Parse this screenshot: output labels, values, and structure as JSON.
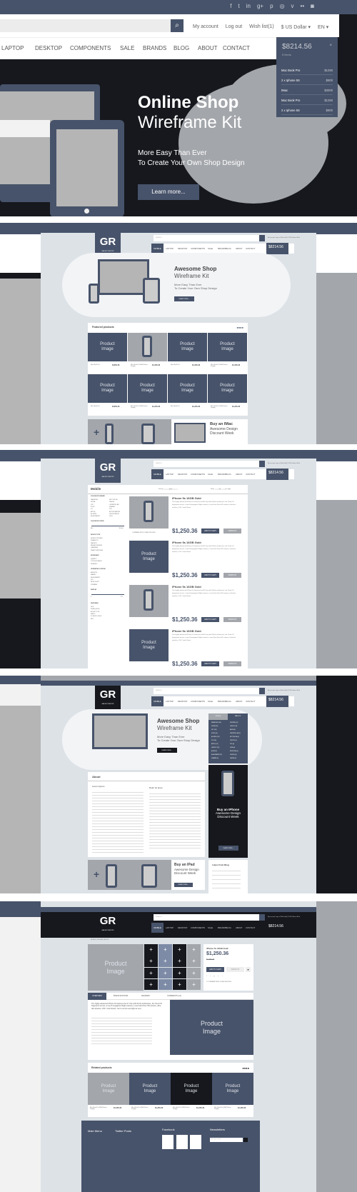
{
  "hero": {
    "social_icons": [
      "facebook-icon",
      "twitter-icon",
      "linkedin-icon",
      "googleplus-icon",
      "pinterest-icon",
      "dribbble-icon",
      "vimeo-icon",
      "flickr-icon",
      "rss-icon"
    ],
    "search_icon": "⌕",
    "links": [
      "My account",
      "Log out",
      "Wish list(1)",
      "$ US Dollar ▾",
      "EN ▾"
    ],
    "nav": [
      "LAPTOP",
      "DESKTOP",
      "COMPONENTS",
      "SALE",
      "BRANDS",
      "BLOG",
      "ABOUT",
      "CONTACT"
    ],
    "cart": {
      "total": "$8214.56",
      "count": "5 items",
      "items": [
        {
          "name": "Mac Book Pro",
          "price": "$1250"
        },
        {
          "name": "2 x Iphone 5S",
          "price": "$900"
        },
        {
          "name": "IMac",
          "price": "$3000"
        },
        {
          "name": "Mac Book Pro",
          "price": "$1250"
        },
        {
          "name": "2 x Iphone 5S",
          "price": "$900"
        }
      ]
    },
    "title_bold": "Online Shop",
    "title_light": "Wireframe Kit",
    "tagline1": "More Easy Than Ever",
    "tagline2": "To Create Your Own Shop Design",
    "learn_more": "Learn more..."
  },
  "mini": {
    "logo": "GR",
    "logo_sub": "GADGET REPORT",
    "search_placeholder": "SEARCH",
    "nav": [
      "MOBILE",
      "LAPTOP",
      "DESKTOP",
      "COMPONENTS",
      "SALE",
      "BRANDS",
      "BLOG",
      "ABOUT",
      "CONTACT"
    ],
    "cart_total": "$8214.56"
  },
  "home": {
    "title_bold": "Awesome Shop",
    "title_light": "Wireframe Kit",
    "tagline1": "More Easy Than Ever",
    "tagline2": "To Create Your Own Shop Design",
    "learn_more": "Learn more...",
    "featured_title": "Featured products",
    "product_placeholder": "Product Image",
    "products": [
      {
        "name": "Mac Book Pro",
        "price": "$1250.36"
      },
      {
        "name": "Mac Book Pro With Retina Display",
        "price": "$1,250.36"
      },
      {
        "name": "Mac Book Pro",
        "price": "$1,250.36"
      },
      {
        "name": "Mac Book Pro With Retina Display",
        "price": "$1,250.36"
      },
      {
        "name": "Mac Book Pro",
        "price": "$1250.36"
      },
      {
        "name": "Mac Book Pro With Retina Display",
        "price": "$1,250.36"
      },
      {
        "name": "Mac Book Pro",
        "price": "$1,250.36"
      },
      {
        "name": "Mac Book Pro With Retina Display",
        "price": "$1,250.36"
      }
    ],
    "promo_bold": "Buy an IMac",
    "promo_l1": "Awesome Design",
    "promo_l2": "Discount Week"
  },
  "listing": {
    "title": "Mobile",
    "sort_label": "Sort by",
    "sort_value": "price",
    "show_label": "Show",
    "show_value": "20",
    "per_page": "per page",
    "brand_head": "CHOOSE BY BRAND",
    "brands_left": [
      "SAMSUNG",
      "NOKIA",
      "HTC",
      "SONY",
      "LG",
      "APPLE",
      "ALCATEL",
      "BLACKBERRY"
    ],
    "brands_right": [
      "MOTOROLA",
      "XIAOMI",
      "CATERPILLAR",
      "HUAWEI",
      "ZTE",
      "ASTON MARTIN",
      "TELEKOMELIK",
      "VIVO"
    ],
    "price_head": "CHOOSE BY PRICE",
    "price_min": "$40",
    "price_max": "$1000",
    "device_head": "DEVICE TYPE",
    "devices": [
      "MOBILE PHONES",
      "PHABLETS",
      "TABLETS",
      "MEDIA PLAYERS",
      "CAMERAS",
      "SMART WATCHES"
    ],
    "keyboard_head": "KEYBOARD",
    "keyboards": [
      "QWERTY",
      "TOUCHSCREEN",
      "NUMERIC"
    ],
    "os_head": "OPERATING SYSTEM",
    "os": [
      "ANDROID",
      "MAEMO",
      "BLACKBERRY",
      "IOS",
      "MICROSOFT",
      "SYMBIAN"
    ],
    "display_head": "DISPLAY",
    "display_min": "2\"",
    "display_max": "5.5\"",
    "features_head": "FEATURES",
    "features": [
      "GPS",
      "WLAN (WI-FI)",
      "BLUETOOTH",
      "RADIO",
      "3.5 AUDIO JACK",
      "NFC"
    ],
    "compare": "COMPARE WITH OTHER DEVICES",
    "item_title": "iPhone 5s 16GB Gold",
    "item_desc": "The highly advanced iPhone 5s features the A7 chip with 64-bit architecture, the Touch ID fingerprint sensor, a new 8-megapixel iSight camera, a new FaceTime HD camera, ultra-fast wireless, iOS 7 and iCloud.",
    "item_price": "$1,250.36",
    "add_to_cart": "ADD TO CART",
    "wishlist": "WISHLIST",
    "product_placeholder": "Product Image"
  },
  "about": {
    "title_bold": "Awesome Shop",
    "title_light": "Wireframe Kit",
    "tagline1": "More Easy Than Ever",
    "tagline2": "To Create Your Own Shop Design",
    "learn_more": "Learn more...",
    "tabs": [
      "MOBILE",
      "TABLETS"
    ],
    "menu_left": [
      "SAMSUNG (104)",
      "NOKIA (76)",
      "HTC (56)",
      "SONY (40)",
      "ALCATEL (32)",
      "ZTE (32)",
      "APPLE (12)",
      "LENOVO (22)",
      "ACER (8)",
      "BLACKBERRY (8)",
      "HUAWEI (8)"
    ],
    "menu_right": [
      "E-MOBILE (2)",
      "LENOVO (8)",
      "ASUS (8)",
      "CATERPILLAR (4)",
      "MOTOROLA (4)",
      "PHILIPS (4)",
      "ZTE (4)",
      "GIGA (4)",
      "BOPHONE (4)",
      "HONOR (4)",
      "XIAOMI (2)"
    ],
    "section_title": "About",
    "col1_head": "Lorem ipsum",
    "col2_head": "Dolor sit amet",
    "promo1_bold": "Buy an IPhone",
    "promo1_l1": "Awesome Design",
    "promo1_l2": "Discount Week",
    "promo2_bold": "Buy an IPad",
    "promo2_l1": "Awesome Design",
    "promo2_l2": "Discount Week",
    "blog_title": "Latest from Blog"
  },
  "detail": {
    "breadcrumb": "MOBILE | PHONES | APPLE",
    "product_placeholder": "Product Image",
    "title": "iPhone 5s 16GB Gold",
    "price": "$1,250.36",
    "old_price": "$1,350.36",
    "add_to_cart": "ADD TO CART",
    "wishlist": "WISHLIST",
    "compare": "COMPARE WITH OTHER DEVICES",
    "tabs": [
      "OVERVIEW",
      "SPECIFICATIONS",
      "REVIEWS",
      "COMMENTS (12)"
    ],
    "overview": "The highly advanced iPhone 5s features the A7 chip with 64-bit architecture, the Touch ID fingerprint sensor, a new 8-megapixel iSight camera, a new FaceTime HD camera, ultra-fast wireless, iOS 7 and iCloud. Yet it's as thin and light as ever.",
    "related_title": "Related products",
    "related": [
      {
        "name": "Mac Book Pro With Retina Display",
        "price": "$1,250.36"
      },
      {
        "name": "Mac Book Pro With Retina Display",
        "price": "$1,250.36"
      },
      {
        "name": "Mac Book Pro With Retina Display",
        "price": "$1,250.36"
      },
      {
        "name": "Mac Book Pro With Retina Display",
        "price": "$1,250.36"
      }
    ],
    "footer": [
      "Main Menu",
      "Twitter Posts",
      "Facebook",
      "Newsletters"
    ],
    "newsletter_placeholder": "Input your email"
  }
}
